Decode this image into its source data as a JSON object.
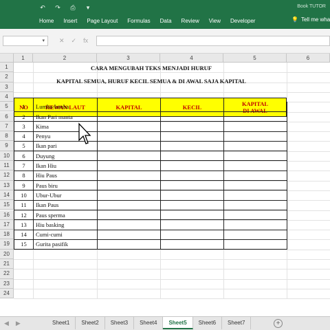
{
  "ribbon": {
    "title": "Book TUTOR",
    "tabs": [
      "Home",
      "Insert",
      "Page Layout",
      "Formulas",
      "Data",
      "Review",
      "View",
      "Developer"
    ],
    "tell_me": "Tell me what",
    "qat_icons": [
      "undo-icon",
      "redo-icon",
      "print-preview-icon",
      "customize-icon"
    ]
  },
  "formula_bar": {
    "name_box": "",
    "fx_label": "fx"
  },
  "columns": [
    "1",
    "2",
    "3",
    "4",
    "5",
    "6"
  ],
  "rows": [
    "1",
    "2",
    "3",
    "4",
    "5",
    "6",
    "7",
    "8",
    "9",
    "10",
    "11",
    "12",
    "13",
    "14",
    "15",
    "16",
    "17",
    "18",
    "19",
    "20",
    "21",
    "22",
    "23",
    "24"
  ],
  "sheet": {
    "title1": "CARA MENGUBAH TEKS MENJADI HURUF",
    "title2": "KAPITAL SEMUA, HURUF KECIL SEMUA & DI AWAL SAJA KAPITAL",
    "headers": {
      "no": "NO",
      "hewan": "HEWAN LAUT",
      "kapital": "KAPITAL",
      "kecil": "KECIL",
      "kapital_awal_1": "KAPITAL",
      "kapital_awal_2": "DI AWAL"
    },
    "data": [
      {
        "no": "1",
        "name": "Lumba-lumba"
      },
      {
        "no": "2",
        "name": "Ikan Pari manta"
      },
      {
        "no": "3",
        "name": "Kima"
      },
      {
        "no": "4",
        "name": "Penyu"
      },
      {
        "no": "5",
        "name": "Ikan pari"
      },
      {
        "no": "6",
        "name": "Duyung"
      },
      {
        "no": "7",
        "name": "Ikan Hiu"
      },
      {
        "no": "8",
        "name": "Hiu Paus"
      },
      {
        "no": "9",
        "name": "Paus biru"
      },
      {
        "no": "10",
        "name": "Ubur-Ubur"
      },
      {
        "no": "11",
        "name": "Ikan Paus"
      },
      {
        "no": "12",
        "name": "Paus sperma"
      },
      {
        "no": "13",
        "name": "Hiu basking"
      },
      {
        "no": "14",
        "name": "Cumi-cumi"
      },
      {
        "no": "15",
        "name": "Gurita pasifik"
      }
    ]
  },
  "sheet_tabs": [
    "Sheet1",
    "Sheet2",
    "Sheet3",
    "Sheet4",
    "Sheet5",
    "Sheet6",
    "Sheet7"
  ],
  "active_sheet": "Sheet5",
  "colors": {
    "ribbon": "#217346",
    "header_fill": "#ffff00",
    "header_text": "#c00000"
  }
}
